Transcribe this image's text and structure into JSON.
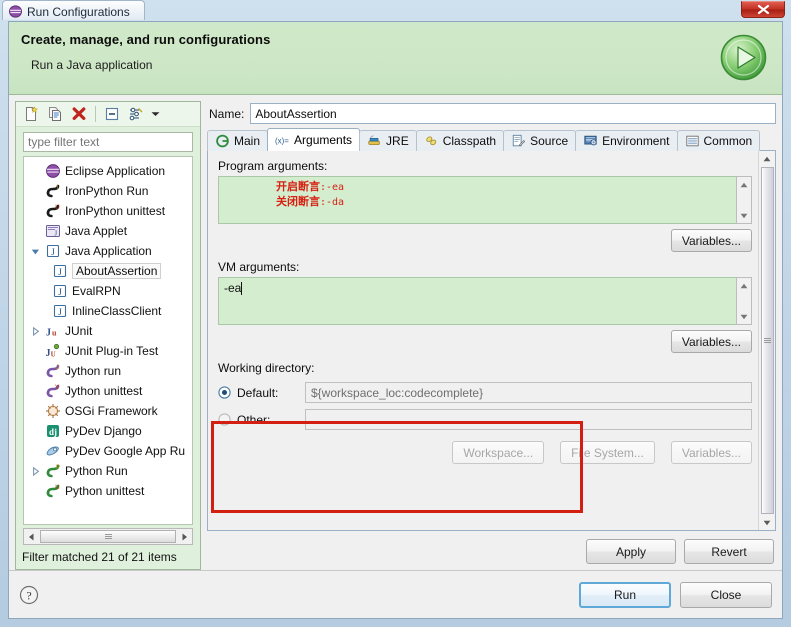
{
  "window": {
    "title": "Run Configurations",
    "title_icon": "eclipse-icon",
    "close_label": "Close window"
  },
  "banner": {
    "title": "Create, manage, and run configurations",
    "subtitle": "Run a Java application",
    "icon": "run-play-icon"
  },
  "tree_toolbar": {
    "buttons": [
      {
        "name": "new-configuration-button",
        "label": "New launch configuration"
      },
      {
        "name": "duplicate-configuration-button",
        "label": "Duplicate"
      },
      {
        "name": "delete-configuration-button",
        "label": "Delete"
      },
      {
        "name": "collapse-all-button",
        "label": "Collapse All"
      },
      {
        "name": "filter-button",
        "label": "Filter launch configurations"
      }
    ],
    "caret_label": "Menu"
  },
  "filter": {
    "placeholder": "type filter text",
    "value": "",
    "status": "Filter matched 21 of 21 items"
  },
  "tree": {
    "items": [
      {
        "label": "Eclipse Application",
        "icon": "eclipse-round-icon",
        "indent": 0,
        "twisty": "none",
        "selected": false
      },
      {
        "label": "IronPython Run",
        "icon": "ironpython-run-icon",
        "indent": 0,
        "twisty": "none",
        "selected": false
      },
      {
        "label": "IronPython unittest",
        "icon": "ironpython-unittest-icon",
        "indent": 0,
        "twisty": "none",
        "selected": false
      },
      {
        "label": "Java Applet",
        "icon": "java-applet-icon",
        "indent": 0,
        "twisty": "none",
        "selected": false
      },
      {
        "label": "Java Application",
        "icon": "java-application-icon",
        "indent": 0,
        "twisty": "expanded",
        "selected": false
      },
      {
        "label": "AboutAssertion",
        "icon": "java-launch-icon",
        "indent": 1,
        "twisty": "none",
        "selected": true
      },
      {
        "label": "EvalRPN",
        "icon": "java-launch-icon",
        "indent": 1,
        "twisty": "none",
        "selected": false
      },
      {
        "label": "InlineClassClient",
        "icon": "java-launch-icon",
        "indent": 1,
        "twisty": "none",
        "selected": false
      },
      {
        "label": "JUnit",
        "icon": "junit-icon",
        "indent": 0,
        "twisty": "collapsed",
        "selected": false
      },
      {
        "label": "JUnit Plug-in Test",
        "icon": "junit-plugin-icon",
        "indent": 0,
        "twisty": "none",
        "selected": false
      },
      {
        "label": "Jython run",
        "icon": "jython-run-icon",
        "indent": 0,
        "twisty": "none",
        "selected": false
      },
      {
        "label": "Jython unittest",
        "icon": "jython-unittest-icon",
        "indent": 0,
        "twisty": "none",
        "selected": false
      },
      {
        "label": "OSGi Framework",
        "icon": "osgi-icon",
        "indent": 0,
        "twisty": "none",
        "selected": false
      },
      {
        "label": "PyDev Django",
        "icon": "django-icon",
        "indent": 0,
        "twisty": "none",
        "selected": false
      },
      {
        "label": "PyDev Google App Ru",
        "icon": "google-app-engine-icon",
        "indent": 0,
        "twisty": "none",
        "selected": false
      },
      {
        "label": "Python Run",
        "icon": "python-run-icon",
        "indent": 0,
        "twisty": "collapsed",
        "selected": false
      },
      {
        "label": "Python unittest",
        "icon": "python-unittest-icon",
        "indent": 0,
        "twisty": "none",
        "selected": false
      }
    ]
  },
  "name_field": {
    "label": "Name:",
    "value": "AboutAssertion"
  },
  "tabs": [
    {
      "label": "Main",
      "icon": "main-tab-icon",
      "active": false
    },
    {
      "label": "Arguments",
      "icon": "arguments-tab-icon",
      "active": true
    },
    {
      "label": "JRE",
      "icon": "jre-tab-icon",
      "active": false
    },
    {
      "label": "Classpath",
      "icon": "classpath-tab-icon",
      "active": false
    },
    {
      "label": "Source",
      "icon": "source-tab-icon",
      "active": false
    },
    {
      "label": "Environment",
      "icon": "environment-tab-icon",
      "active": false
    },
    {
      "label": "Common",
      "icon": "common-tab-icon",
      "active": false
    }
  ],
  "program_arguments": {
    "label": "Program arguments:",
    "annotation_line1_cjk": "开启断言",
    "annotation_line1_arg": ":-ea",
    "annotation_line2_cjk": "关闭断言",
    "annotation_line2_arg": ":-da",
    "variables_button": "Variables..."
  },
  "vm_arguments": {
    "label": "VM arguments:",
    "value": "-ea",
    "variables_button": "Variables...",
    "highlight_color": "#d21f12"
  },
  "working_directory": {
    "label": "Working directory:",
    "default_radio_label": "Default:",
    "default_value": "${workspace_loc:codecomplete}",
    "other_radio_label": "Other:",
    "other_value": "",
    "selected": "default",
    "buttons": [
      {
        "label": "Workspace...",
        "name": "workspace-button",
        "disabled": true
      },
      {
        "label": "File System...",
        "name": "file-system-button",
        "disabled": true
      },
      {
        "label": "Variables...",
        "name": "variables-button",
        "disabled": true
      }
    ]
  },
  "actions": {
    "apply": "Apply",
    "revert": "Revert"
  },
  "footer": {
    "help_icon": "help-icon",
    "run": "Run",
    "close": "Close"
  }
}
